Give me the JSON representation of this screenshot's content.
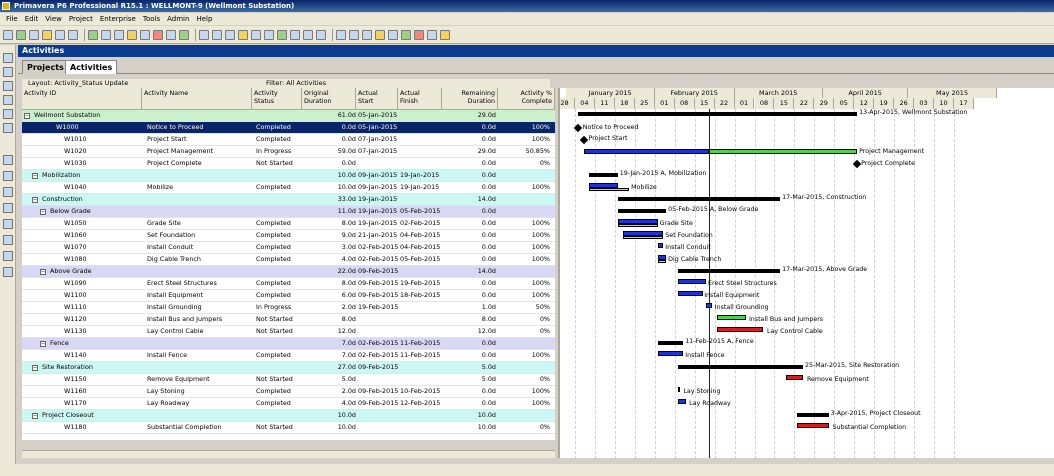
{
  "window": {
    "title": "Primavera P6 Professional R15.1 : WELLMONT-9 (Wellmont Substation)"
  },
  "menu": [
    "File",
    "Edit",
    "View",
    "Project",
    "Enterprise",
    "Tools",
    "Admin",
    "Help"
  ],
  "header": {
    "title": "Activities"
  },
  "tabs": [
    "Projects",
    "Activities"
  ],
  "layout": {
    "label": "Layout: Activity_Status Update",
    "filter": "Filter: All Activities"
  },
  "columns": {
    "id": "Activity ID",
    "name": "Activity Name",
    "status": "Activity Status",
    "od": "Original Duration",
    "as": "Actual Start",
    "af": "Actual Finish",
    "rd": "Remaining Duration",
    "pct": "Activity % Complete"
  },
  "rows": [
    {
      "id": "Wellmont Substation",
      "name": "",
      "status": "",
      "od": "61.0d",
      "as": "05-Jan-2015",
      "af": "",
      "rd": "29.0d",
      "pct": "",
      "type": "wbs0"
    },
    {
      "id": "W1000",
      "name": "Notice to Proceed",
      "status": "Completed",
      "od": "0.0d",
      "as": "05-Jan-2015",
      "af": "",
      "rd": "0.0d",
      "pct": "100%",
      "type": "sel"
    },
    {
      "id": "W1010",
      "name": "Project Start",
      "status": "Completed",
      "od": "0.0d",
      "as": "07-Jan-2015",
      "af": "",
      "rd": "0.0d",
      "pct": "100%",
      "type": "act"
    },
    {
      "id": "W1020",
      "name": "Project Management",
      "status": "In Progress",
      "od": "59.0d",
      "as": "07-Jan-2015",
      "af": "",
      "rd": "29.0d",
      "pct": "50.85%",
      "type": "act"
    },
    {
      "id": "W1030",
      "name": "Project Complete",
      "status": "Not Started",
      "od": "0.0d",
      "as": "",
      "af": "",
      "rd": "0.0d",
      "pct": "0%",
      "type": "act"
    },
    {
      "id": "Mobilization",
      "name": "",
      "status": "",
      "od": "10.0d",
      "as": "09-Jan-2015",
      "af": "19-Jan-2015",
      "rd": "0.0d",
      "pct": "",
      "type": "wbs1"
    },
    {
      "id": "W1040",
      "name": "Mobilize",
      "status": "Completed",
      "od": "10.0d",
      "as": "09-Jan-2015",
      "af": "19-Jan-2015",
      "rd": "0.0d",
      "pct": "100%",
      "type": "act"
    },
    {
      "id": "Construction",
      "name": "",
      "status": "",
      "od": "33.0d",
      "as": "19-Jan-2015",
      "af": "",
      "rd": "14.0d",
      "pct": "",
      "type": "wbs1"
    },
    {
      "id": "Below Grade",
      "name": "",
      "status": "",
      "od": "11.0d",
      "as": "19-Jan-2015",
      "af": "05-Feb-2015",
      "rd": "0.0d",
      "pct": "",
      "type": "wbs2"
    },
    {
      "id": "W1050",
      "name": "Grade Site",
      "status": "Completed",
      "od": "8.0d",
      "as": "19-Jan-2015",
      "af": "02-Feb-2015",
      "rd": "0.0d",
      "pct": "100%",
      "type": "act"
    },
    {
      "id": "W1060",
      "name": "Set Foundation",
      "status": "Completed",
      "od": "9.0d",
      "as": "21-Jan-2015",
      "af": "04-Feb-2015",
      "rd": "0.0d",
      "pct": "100%",
      "type": "act"
    },
    {
      "id": "W1070",
      "name": "Install Conduit",
      "status": "Completed",
      "od": "3.0d",
      "as": "02-Feb-2015",
      "af": "04-Feb-2015",
      "rd": "0.0d",
      "pct": "100%",
      "type": "act"
    },
    {
      "id": "W1080",
      "name": "Dig Cable Trench",
      "status": "Completed",
      "od": "4.0d",
      "as": "02-Feb-2015",
      "af": "05-Feb-2015",
      "rd": "0.0d",
      "pct": "100%",
      "type": "act"
    },
    {
      "id": "Above Grade",
      "name": "",
      "status": "",
      "od": "22.0d",
      "as": "09-Feb-2015",
      "af": "",
      "rd": "14.0d",
      "pct": "",
      "type": "wbs2"
    },
    {
      "id": "W1090",
      "name": "Erect Steel Structures",
      "status": "Completed",
      "od": "8.0d",
      "as": "09-Feb-2015",
      "af": "19-Feb-2015",
      "rd": "0.0d",
      "pct": "100%",
      "type": "act"
    },
    {
      "id": "W1100",
      "name": "Install Equipment",
      "status": "Completed",
      "od": "6.0d",
      "as": "09-Feb-2015",
      "af": "18-Feb-2015",
      "rd": "0.0d",
      "pct": "100%",
      "type": "act"
    },
    {
      "id": "W1110",
      "name": "Install Grounding",
      "status": "In Progress",
      "od": "2.0d",
      "as": "19-Feb-2015",
      "af": "",
      "rd": "1.0d",
      "pct": "50%",
      "type": "act"
    },
    {
      "id": "W1120",
      "name": "Install Bus and Jumpers",
      "status": "Not Started",
      "od": "8.0d",
      "as": "",
      "af": "",
      "rd": "8.0d",
      "pct": "0%",
      "type": "act"
    },
    {
      "id": "W1130",
      "name": "Lay Control Cable",
      "status": "Not Started",
      "od": "12.0d",
      "as": "",
      "af": "",
      "rd": "12.0d",
      "pct": "0%",
      "type": "act"
    },
    {
      "id": "Fence",
      "name": "",
      "status": "",
      "od": "7.0d",
      "as": "02-Feb-2015",
      "af": "11-Feb-2015",
      "rd": "0.0d",
      "pct": "",
      "type": "wbs2"
    },
    {
      "id": "W1140",
      "name": "Install Fence",
      "status": "Completed",
      "od": "7.0d",
      "as": "02-Feb-2015",
      "af": "11-Feb-2015",
      "rd": "0.0d",
      "pct": "100%",
      "type": "act"
    },
    {
      "id": "Site Restoration",
      "name": "",
      "status": "",
      "od": "27.0d",
      "as": "09-Feb-2015",
      "af": "",
      "rd": "5.0d",
      "pct": "",
      "type": "wbs1"
    },
    {
      "id": "W1150",
      "name": "Remove Equipment",
      "status": "Not Started",
      "od": "5.0d",
      "as": "",
      "af": "",
      "rd": "5.0d",
      "pct": "0%",
      "type": "act"
    },
    {
      "id": "W1160",
      "name": "Lay Stoning",
      "status": "Completed",
      "od": "2.0d",
      "as": "09-Feb-2015",
      "af": "10-Feb-2015",
      "rd": "0.0d",
      "pct": "100%",
      "type": "act"
    },
    {
      "id": "W1170",
      "name": "Lay Roadway",
      "status": "Completed",
      "od": "4.0d",
      "as": "09-Feb-2015",
      "af": "12-Feb-2015",
      "rd": "0.0d",
      "pct": "100%",
      "type": "act"
    },
    {
      "id": "Project Closeout",
      "name": "",
      "status": "",
      "od": "10.0d",
      "as": "",
      "af": "",
      "rd": "10.0d",
      "pct": "",
      "type": "wbs1"
    },
    {
      "id": "W1180",
      "name": "Substantial Completion",
      "status": "Not Started",
      "od": "10.0d",
      "as": "",
      "af": "",
      "rd": "10.0d",
      "pct": "0%",
      "type": "act"
    }
  ],
  "gantt": {
    "months": [
      "January 2015",
      "February 2015",
      "March 2015",
      "April 2015",
      "May 2015"
    ],
    "days": [
      "28",
      "04",
      "11",
      "18",
      "25",
      "01",
      "08",
      "15",
      "22",
      "01",
      "08",
      "15",
      "22",
      "29",
      "05",
      "12",
      "19",
      "26",
      "03",
      "10",
      "17"
    ],
    "labels": [
      "13-Apr-2015, Wellmont Substation",
      "Notice to Proceed",
      "Project Start",
      "Project Management",
      "Project Complete",
      "19-Jan-2015 A, Mobilization",
      "Mobilize",
      "17-Mar-2015, Construction",
      "05-Feb-2015 A, Below Grade",
      "Grade Site",
      "Set Foundation",
      "Install Conduit",
      "Dig Cable Trench",
      "17-Mar-2015, Above Grade",
      "Erect Steel Structures",
      "Install Equipment",
      "Install Grounding",
      "Install Bus and Jumpers",
      "Lay Control Cable",
      "11-Feb-2015 A, Fence",
      "Install Fence",
      "25-Mar-2015, Site Restoration",
      "Remove Equipment",
      "Lay Stoning",
      "Lay Roadway",
      "3-Apr-2015, Project Closeout",
      "Substantial Completion"
    ]
  }
}
